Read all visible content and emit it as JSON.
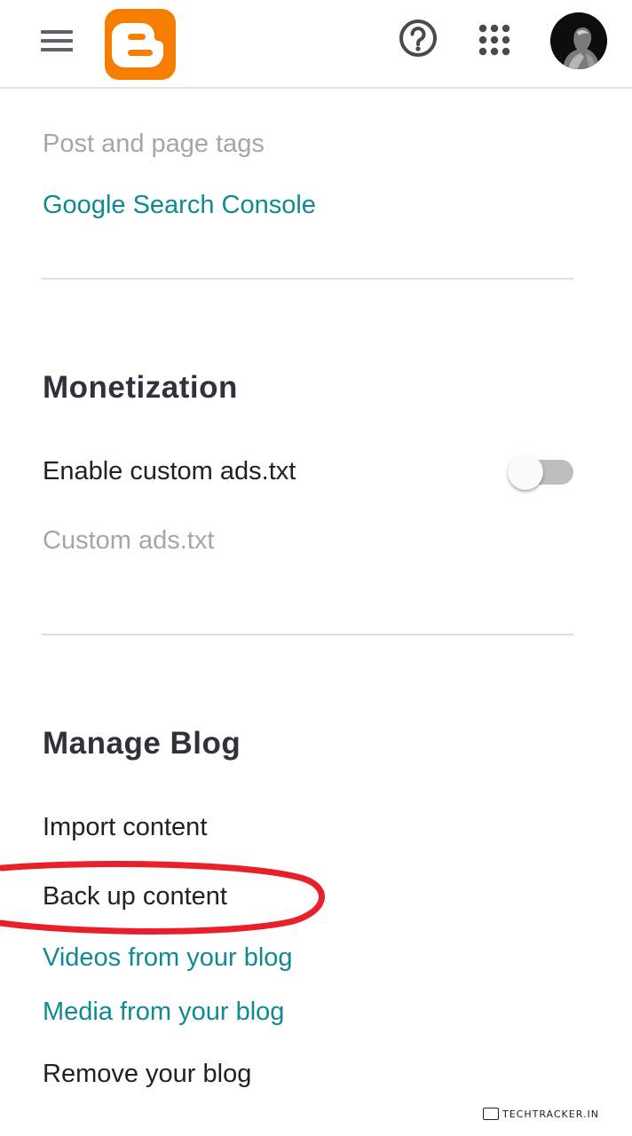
{
  "appbar": {
    "menu_icon": "hamburger-menu-icon",
    "logo_icon": "blogger-logo-icon",
    "help_icon": "help-circle-icon",
    "apps_icon": "google-apps-grid-icon",
    "avatar_icon": "user-avatar",
    "brand_color": "#f57d00"
  },
  "seo": {
    "post_page_tags": "Post and page tags",
    "search_console": "Google Search Console"
  },
  "monetization": {
    "heading": "Monetization",
    "enable_ads_txt": "Enable custom ads.txt",
    "enable_ads_txt_on": false,
    "custom_ads_txt": "Custom ads.txt"
  },
  "manage_blog": {
    "heading": "Manage Blog",
    "import_content": "Import content",
    "back_up_content": "Back up content",
    "videos": "Videos from your blog",
    "media": "Media from your blog",
    "remove": "Remove your blog"
  },
  "annotation": {
    "ring_color": "#e8202a"
  },
  "watermark": {
    "text": "TECHTRACKER.IN"
  },
  "colors": {
    "link": "#0f8a93",
    "disabled": "#a6a6a6",
    "text": "#202124",
    "heading": "#2d3338"
  }
}
